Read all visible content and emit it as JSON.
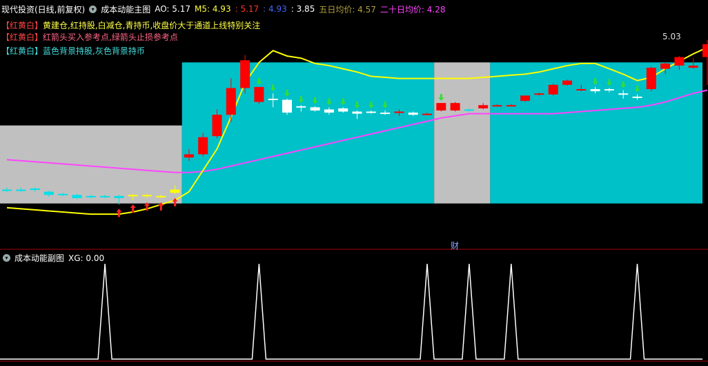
{
  "header": {
    "title": "现代投资(日线,前复权)",
    "indicator": "成本动能主图",
    "ao": "AO: 5.17",
    "m5": "M5: 4.93",
    "v1": ": 5.17",
    "v2": ": 4.93",
    "v3": ": 3.85",
    "ma5": "五日均价: 4.57",
    "ma20": "二十日均价: 4.28"
  },
  "legend": [
    {
      "tag": "【红黄白】",
      "text": "黄建仓,红持股,白减仓,青持币,收盘价大于通道上线特别关注",
      "color": "#ffff44"
    },
    {
      "tag": "【红黄白】",
      "text": "红箭头买入参考点,绿箭头止损参考点",
      "color": "#ff6688"
    },
    {
      "tag": "【红黄白】",
      "text": "蓝色背景持股,灰色背景持币",
      "color": "#44dddd"
    }
  ],
  "peak_label": "5.03",
  "cai_label": "财",
  "sub": {
    "title": "成本动能副图",
    "xg": "XG: 0.00"
  },
  "colors": {
    "bg": "#000000",
    "cyan_band": "#00c0c8",
    "gray_band": "#c0c0c0",
    "up": "#ff0000",
    "down": "#ffffff",
    "ma5": "#ffff00",
    "ma20": "#ff44ff",
    "divider": "#aa0000"
  },
  "chart_data": {
    "type": "candlestick",
    "count": 50,
    "ylim": [
      3.2,
      5.3
    ],
    "candles": [
      {
        "o": 3.72,
        "h": 3.74,
        "l": 3.7,
        "c": 3.71,
        "s": "c"
      },
      {
        "o": 3.72,
        "h": 3.74,
        "l": 3.7,
        "c": 3.71,
        "s": "c"
      },
      {
        "o": 3.73,
        "h": 3.74,
        "l": 3.7,
        "c": 3.72,
        "s": "c"
      },
      {
        "o": 3.7,
        "h": 3.71,
        "l": 3.65,
        "c": 3.67,
        "s": "c"
      },
      {
        "o": 3.68,
        "h": 3.69,
        "l": 3.66,
        "c": 3.68,
        "s": "c"
      },
      {
        "o": 3.67,
        "h": 3.68,
        "l": 3.63,
        "c": 3.64,
        "s": "c"
      },
      {
        "o": 3.66,
        "h": 3.67,
        "l": 3.64,
        "c": 3.65,
        "s": "c"
      },
      {
        "o": 3.66,
        "h": 3.67,
        "l": 3.64,
        "c": 3.65,
        "s": "c"
      },
      {
        "o": 3.66,
        "h": 3.67,
        "l": 3.58,
        "c": 3.64,
        "s": "c"
      },
      {
        "o": 3.66,
        "h": 3.68,
        "l": 3.62,
        "c": 3.67,
        "s": "y"
      },
      {
        "o": 3.66,
        "h": 3.68,
        "l": 3.64,
        "c": 3.67,
        "s": "y"
      },
      {
        "o": 3.66,
        "h": 3.67,
        "l": 3.64,
        "c": 3.66,
        "s": "y"
      },
      {
        "o": 3.72,
        "h": 3.76,
        "l": 3.68,
        "c": 3.69,
        "s": "y"
      },
      {
        "o": 4.02,
        "h": 4.1,
        "l": 3.99,
        "c": 4.05,
        "s": "r"
      },
      {
        "o": 4.05,
        "h": 4.25,
        "l": 4.03,
        "c": 4.21,
        "s": "r"
      },
      {
        "o": 4.22,
        "h": 4.47,
        "l": 4.2,
        "c": 4.42,
        "s": "r"
      },
      {
        "o": 4.42,
        "h": 4.76,
        "l": 4.35,
        "c": 4.67,
        "s": "r"
      },
      {
        "o": 4.67,
        "h": 4.98,
        "l": 4.62,
        "c": 4.93,
        "s": "r"
      },
      {
        "o": 4.68,
        "h": 4.68,
        "l": 4.52,
        "c": 4.54,
        "s": "r"
      },
      {
        "o": 4.57,
        "h": 4.62,
        "l": 4.49,
        "c": 4.57,
        "s": "w"
      },
      {
        "o": 4.56,
        "h": 4.57,
        "l": 4.42,
        "c": 4.44,
        "s": "w"
      },
      {
        "o": 4.5,
        "h": 4.51,
        "l": 4.45,
        "c": 4.5,
        "s": "w"
      },
      {
        "o": 4.49,
        "h": 4.5,
        "l": 4.45,
        "c": 4.46,
        "s": "w"
      },
      {
        "o": 4.47,
        "h": 4.49,
        "l": 4.42,
        "c": 4.44,
        "s": "w"
      },
      {
        "o": 4.48,
        "h": 4.49,
        "l": 4.44,
        "c": 4.45,
        "s": "w"
      },
      {
        "o": 4.45,
        "h": 4.46,
        "l": 4.38,
        "c": 4.43,
        "s": "w"
      },
      {
        "o": 4.45,
        "h": 4.46,
        "l": 4.43,
        "c": 4.44,
        "s": "w"
      },
      {
        "o": 4.44,
        "h": 4.46,
        "l": 4.42,
        "c": 4.43,
        "s": "w"
      },
      {
        "o": 4.45,
        "h": 4.47,
        "l": 4.41,
        "c": 4.45,
        "s": "r"
      },
      {
        "o": 4.44,
        "h": 4.45,
        "l": 4.41,
        "c": 4.42,
        "s": "w"
      },
      {
        "o": 4.43,
        "h": 4.44,
        "l": 4.42,
        "c": 4.43,
        "s": "r"
      },
      {
        "o": 4.46,
        "h": 4.53,
        "l": 4.45,
        "c": 4.53,
        "s": "r"
      },
      {
        "o": 4.53,
        "h": 4.54,
        "l": 4.45,
        "c": 4.46,
        "s": "r"
      },
      {
        "o": 4.47,
        "h": 4.48,
        "l": 4.45,
        "c": 4.46,
        "s": "c"
      },
      {
        "o": 4.48,
        "h": 4.53,
        "l": 4.47,
        "c": 4.51,
        "s": "r"
      },
      {
        "o": 4.51,
        "h": 4.52,
        "l": 4.5,
        "c": 4.51,
        "s": "r"
      },
      {
        "o": 4.51,
        "h": 4.52,
        "l": 4.5,
        "c": 4.51,
        "s": "r"
      },
      {
        "o": 4.55,
        "h": 4.6,
        "l": 4.54,
        "c": 4.6,
        "s": "r"
      },
      {
        "o": 4.61,
        "h": 4.63,
        "l": 4.6,
        "c": 4.62,
        "s": "r"
      },
      {
        "o": 4.61,
        "h": 4.71,
        "l": 4.6,
        "c": 4.7,
        "s": "r"
      },
      {
        "o": 4.7,
        "h": 4.75,
        "l": 4.69,
        "c": 4.74,
        "s": "r"
      },
      {
        "o": 4.66,
        "h": 4.7,
        "l": 4.64,
        "c": 4.66,
        "s": "r"
      },
      {
        "o": 4.64,
        "h": 4.68,
        "l": 4.62,
        "c": 4.66,
        "s": "w"
      },
      {
        "o": 4.66,
        "h": 4.67,
        "l": 4.63,
        "c": 4.65,
        "s": "w"
      },
      {
        "o": 4.62,
        "h": 4.65,
        "l": 4.57,
        "c": 4.61,
        "s": "w"
      },
      {
        "o": 4.59,
        "h": 4.61,
        "l": 4.56,
        "c": 4.58,
        "s": "w"
      },
      {
        "o": 4.66,
        "h": 4.87,
        "l": 4.64,
        "c": 4.86,
        "s": "r"
      },
      {
        "o": 4.85,
        "h": 4.91,
        "l": 4.8,
        "c": 4.9,
        "s": "r"
      },
      {
        "o": 4.88,
        "h": 4.97,
        "l": 4.84,
        "c": 4.96,
        "s": "r"
      },
      {
        "o": 4.86,
        "h": 4.95,
        "l": 4.85,
        "c": 4.88,
        "s": "r"
      },
      {
        "o": 4.96,
        "h": 5.12,
        "l": 4.7,
        "c": 5.08,
        "s": "r"
      }
    ],
    "ma5": [
      3.55,
      3.54,
      3.53,
      3.52,
      3.51,
      3.5,
      3.49,
      3.49,
      3.49,
      3.51,
      3.54,
      3.58,
      3.62,
      3.7,
      3.9,
      4.1,
      4.4,
      4.72,
      4.91,
      5.02,
      4.97,
      4.95,
      4.9,
      4.88,
      4.85,
      4.82,
      4.78,
      4.77,
      4.76,
      4.76,
      4.76,
      4.76,
      4.76,
      4.76,
      4.77,
      4.78,
      4.79,
      4.8,
      4.82,
      4.85,
      4.88,
      4.9,
      4.9,
      4.85,
      4.8,
      4.74,
      4.77,
      4.85,
      4.92,
      4.99,
      5.05
    ],
    "ma20": [
      4.0,
      3.99,
      3.98,
      3.97,
      3.96,
      3.95,
      3.94,
      3.93,
      3.92,
      3.91,
      3.9,
      3.89,
      3.88,
      3.88,
      3.89,
      3.91,
      3.94,
      3.97,
      4.0,
      4.03,
      4.06,
      4.09,
      4.12,
      4.15,
      4.18,
      4.21,
      4.24,
      4.27,
      4.3,
      4.33,
      4.36,
      4.39,
      4.41,
      4.43,
      4.43,
      4.43,
      4.43,
      4.43,
      4.43,
      4.43,
      4.44,
      4.45,
      4.46,
      4.47,
      4.48,
      4.49,
      4.51,
      4.54,
      4.58,
      4.62,
      4.65
    ],
    "bands": [
      {
        "from": 0,
        "to": 12.5,
        "kind": "gray",
        "top": 4.32,
        "bottom": 3.59
      },
      {
        "from": 12.5,
        "to": 30.5,
        "kind": "cyan",
        "top": 4.91,
        "bottom": 3.59
      },
      {
        "from": 30.5,
        "to": 34.5,
        "kind": "gray",
        "top": 4.91,
        "bottom": 3.59
      },
      {
        "from": 34.5,
        "to": 49.5,
        "kind": "cyan",
        "top": 4.91,
        "bottom": 3.59
      }
    ],
    "buy_arrows": [
      8,
      9,
      10,
      11,
      12
    ],
    "stop_arrows": [
      18,
      19,
      20,
      21,
      22,
      23,
      24,
      25,
      26,
      27,
      31,
      42,
      43,
      44,
      45
    ],
    "xg_peaks": [
      7,
      18,
      30,
      33,
      36,
      45
    ]
  }
}
